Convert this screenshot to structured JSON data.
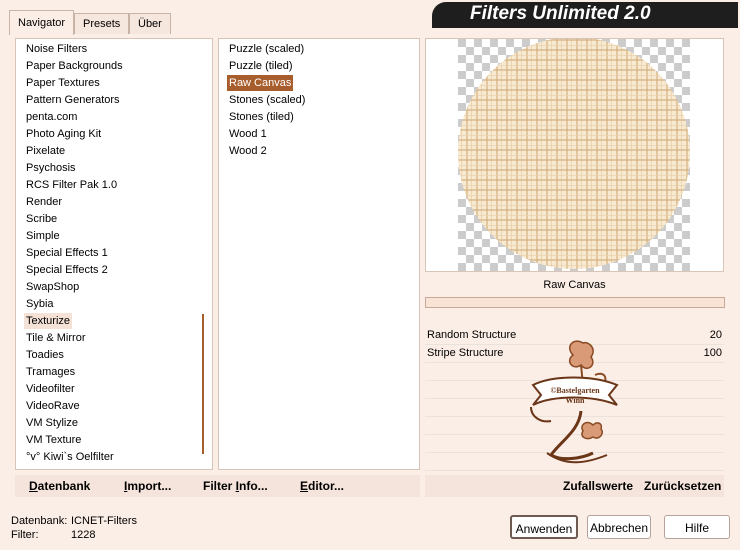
{
  "tabs": [
    "Navigator",
    "Presets",
    "Über"
  ],
  "app_title": "Filters Unlimited 2.0",
  "categories": [
    "Noise Filters",
    "Paper Backgrounds",
    "Paper Textures",
    "Pattern Generators",
    "penta.com",
    "Photo Aging Kit",
    "Pixelate",
    "Psychosis",
    "RCS Filter Pak 1.0",
    "Render",
    "Scribe",
    "Simple",
    "Special Effects 1",
    "Special Effects 2",
    "SwapShop",
    "Sybia",
    "Texturize",
    "Tile & Mirror",
    "Toadies",
    "Tramages",
    "Videofilter",
    "VideoRave",
    "VM Stylize",
    "VM Texture",
    "°v° Kiwi`s Oelfilter"
  ],
  "selected_category": "Texturize",
  "filters": [
    "Puzzle (scaled)",
    "Puzzle (tiled)",
    "Raw Canvas",
    "Stones (scaled)",
    "Stones (tiled)",
    "Wood 1",
    "Wood 2"
  ],
  "selected_filter": "Raw Canvas",
  "preview_filter_name": "Raw Canvas",
  "params": [
    {
      "label": "Random Structure",
      "value": "20"
    },
    {
      "label": "Stripe Structure",
      "value": "100"
    }
  ],
  "watermark": {
    "line1": "©Bastelgarten",
    "line2": "Winn"
  },
  "left_buttons": {
    "database_pre": "D",
    "database_rest": "atenbank",
    "import_pre": "I",
    "import_rest": "mport...",
    "filterinfo_pre": "Filter ",
    "filterinfo_u": "I",
    "filterinfo_rest": "nfo...",
    "editor_pre": "E",
    "editor_rest": "ditor..."
  },
  "right_buttons": {
    "random": "Zufallswerte",
    "reset": "Zurücksetzen"
  },
  "status": {
    "db_label": "Datenbank:",
    "db_value": "ICNET-Filters",
    "filter_label": "Filter:",
    "filter_value": "1228"
  },
  "dialog_buttons": {
    "apply": "Anwenden",
    "cancel": "Abbrechen",
    "help": "Hilfe"
  },
  "colors": {
    "accent": "#a85d2c",
    "background": "#fbeee7",
    "title_bg": "#1e1e1e"
  }
}
